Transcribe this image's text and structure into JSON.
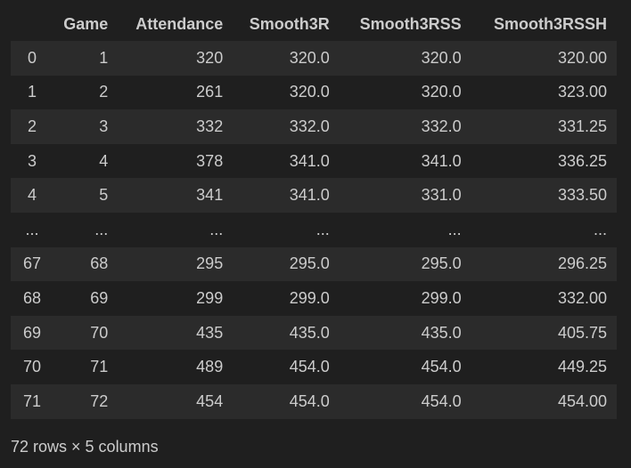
{
  "dataframe": {
    "columns": [
      "",
      "Game",
      "Attendance",
      "Smooth3R",
      "Smooth3RSS",
      "Smooth3RSSH"
    ],
    "rows": [
      [
        "0",
        "1",
        "320",
        "320.0",
        "320.0",
        "320.00"
      ],
      [
        "1",
        "2",
        "261",
        "320.0",
        "320.0",
        "323.00"
      ],
      [
        "2",
        "3",
        "332",
        "332.0",
        "332.0",
        "331.25"
      ],
      [
        "3",
        "4",
        "378",
        "341.0",
        "341.0",
        "336.25"
      ],
      [
        "4",
        "5",
        "341",
        "341.0",
        "331.0",
        "333.50"
      ],
      [
        "...",
        "...",
        "...",
        "...",
        "...",
        "..."
      ],
      [
        "67",
        "68",
        "295",
        "295.0",
        "295.0",
        "296.25"
      ],
      [
        "68",
        "69",
        "299",
        "299.0",
        "299.0",
        "332.00"
      ],
      [
        "69",
        "70",
        "435",
        "435.0",
        "435.0",
        "405.75"
      ],
      [
        "70",
        "71",
        "489",
        "454.0",
        "454.0",
        "449.25"
      ],
      [
        "71",
        "72",
        "454",
        "454.0",
        "454.0",
        "454.00"
      ]
    ],
    "summary": "72 rows × 5 columns"
  },
  "colors": {
    "background": "#1f1f1f",
    "row_stripe": "#2b2b2b",
    "text": "#cccccc"
  }
}
